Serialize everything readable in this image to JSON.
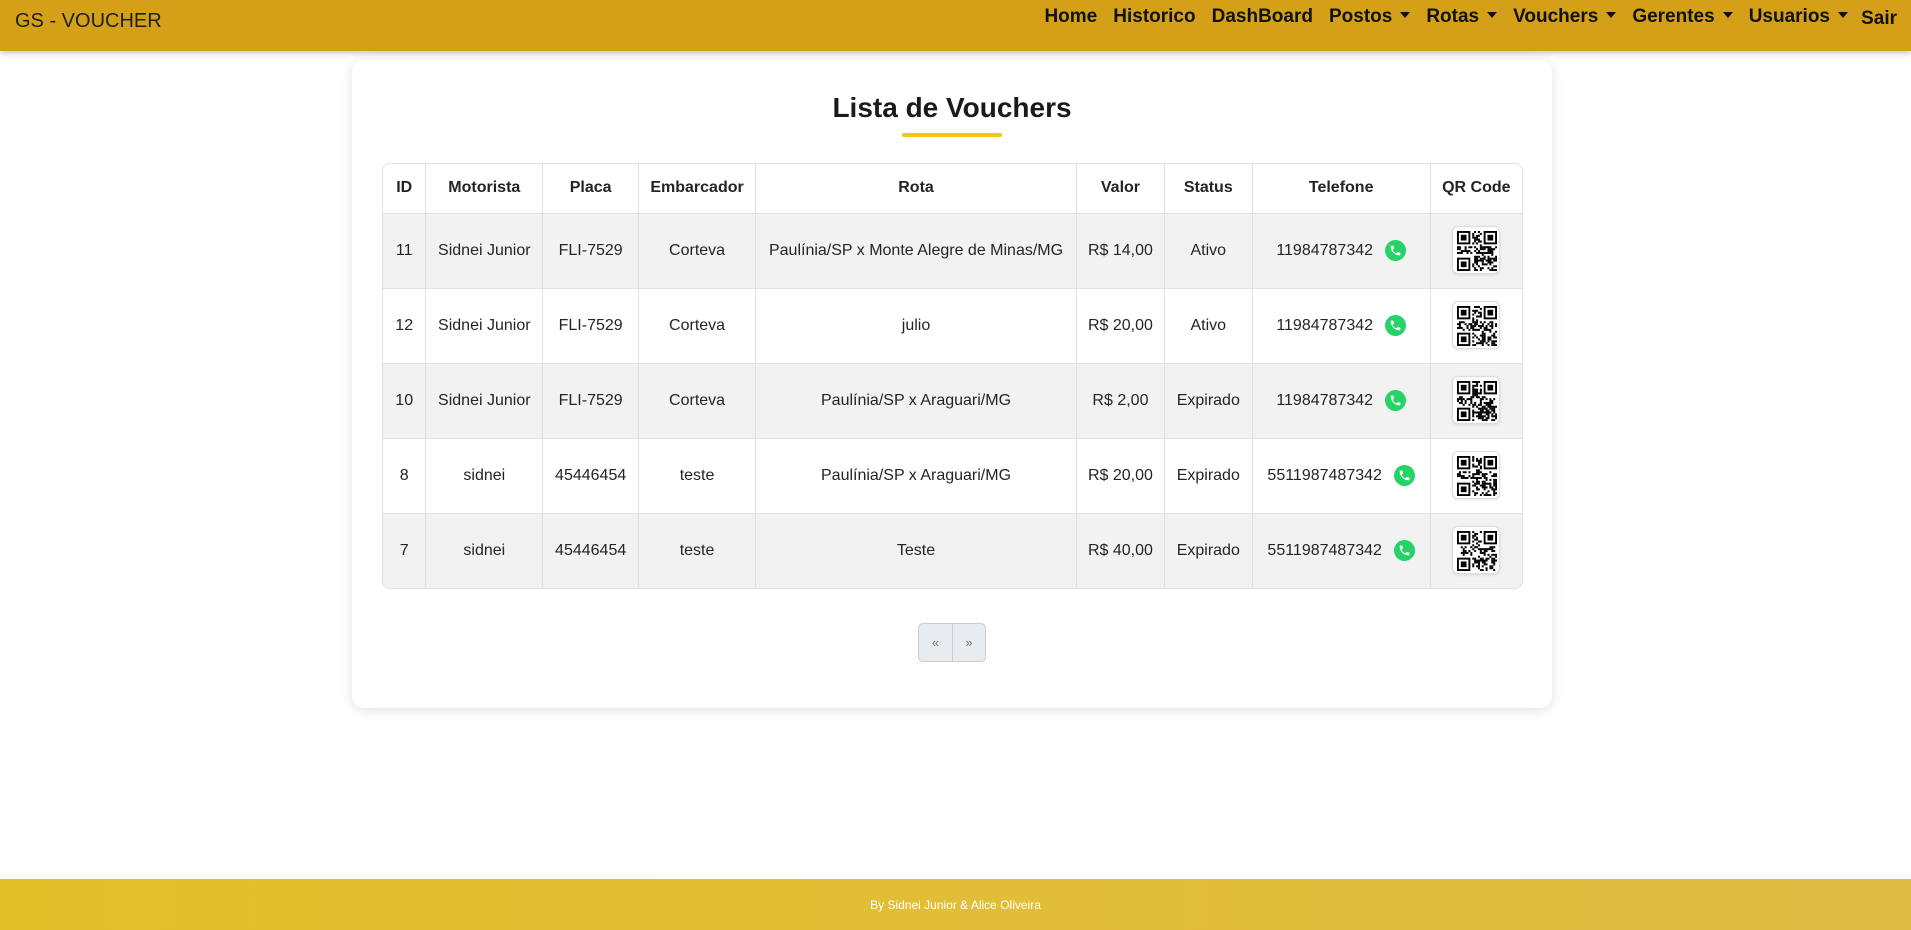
{
  "navbar": {
    "brand": "GS - VOUCHER",
    "links": [
      {
        "label": "Home",
        "dropdown": false
      },
      {
        "label": "Historico",
        "dropdown": false
      },
      {
        "label": "DashBoard",
        "dropdown": false
      },
      {
        "label": "Postos",
        "dropdown": true
      },
      {
        "label": "Rotas",
        "dropdown": true
      },
      {
        "label": "Vouchers",
        "dropdown": true
      },
      {
        "label": "Gerentes",
        "dropdown": true
      },
      {
        "label": "Usuarios",
        "dropdown": true
      }
    ],
    "logout": "Sair",
    "color": "#d4a017"
  },
  "main": {
    "title": "Lista de Vouchers",
    "accent_color": "#f2c811",
    "table": {
      "headers": [
        "ID",
        "Motorista",
        "Placa",
        "Embarcador",
        "Rota",
        "Valor",
        "Status",
        "Telefone",
        "QR Code"
      ],
      "rows": [
        {
          "id": "11",
          "motorista": "Sidnei Junior",
          "placa": "FLI-7529",
          "embarcador": "Corteva",
          "rota": "Paulínia/SP x Monte Alegre de Minas/MG",
          "valor": "R$ 14,00",
          "status": "Ativo",
          "telefone": "11984787342"
        },
        {
          "id": "12",
          "motorista": "Sidnei Junior",
          "placa": "FLI-7529",
          "embarcador": "Corteva",
          "rota": "julio",
          "valor": "R$ 20,00",
          "status": "Ativo",
          "telefone": "11984787342"
        },
        {
          "id": "10",
          "motorista": "Sidnei Junior",
          "placa": "FLI-7529",
          "embarcador": "Corteva",
          "rota": "Paulínia/SP x Araguari/MG",
          "valor": "R$ 2,00",
          "status": "Expirado",
          "telefone": "11984787342"
        },
        {
          "id": "8",
          "motorista": "sidnei",
          "placa": "45446454",
          "embarcador": "teste",
          "rota": "Paulínia/SP x Araguari/MG",
          "valor": "R$ 20,00",
          "status": "Expirado",
          "telefone": "5511987487342"
        },
        {
          "id": "7",
          "motorista": "sidnei",
          "placa": "45446454",
          "embarcador": "teste",
          "rota": "Teste",
          "valor": "R$ 40,00",
          "status": "Expirado",
          "telefone": "5511987487342"
        }
      ],
      "phone_icon": "whatsapp-icon",
      "qr_icon": "qr-code-icon"
    },
    "pagination": {
      "prev": "«",
      "next": "»"
    }
  },
  "footer": {
    "text": "By Sidnei Junior & Alice Oliveira"
  }
}
